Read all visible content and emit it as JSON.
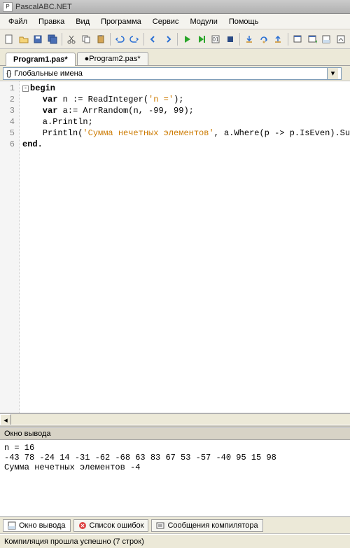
{
  "window": {
    "title": "PascalABC.NET"
  },
  "menu": {
    "file": "Файл",
    "edit": "Правка",
    "view": "Вид",
    "program": "Программа",
    "service": "Сервис",
    "modules": "Модули",
    "help": "Помощь"
  },
  "tabs": {
    "active": "Program1.pas*",
    "other": "●Program2.pas*"
  },
  "scope": {
    "label": "Глобальные имена"
  },
  "code": {
    "line1": "begin",
    "line2_a": "    var",
    "line2_b": " n := ReadInteger(",
    "line2_c": "'n ='",
    "line2_d": ");",
    "line3_a": "    var",
    "line3_b": " a:= ArrRandom(n, -99, 99);",
    "line4": "    a.Println;",
    "line5_a": "    Println(",
    "line5_b": "'Сумма нечетных элементов'",
    "line5_c": ", a.Where(p -> p.IsEven).Sum)",
    "line6": "end."
  },
  "gutter": [
    "1",
    "2",
    "3",
    "4",
    "5",
    "6"
  ],
  "output": {
    "title": "Окно вывода",
    "text": "n = 16\n-43 78 -24 14 -31 -62 -68 63 83 67 53 -57 -40 95 15 98\nСумма нечетных элементов -4"
  },
  "bottomTabs": {
    "output": "Окно вывода",
    "errors": "Список ошибок",
    "compiler": "Сообщения компилятора"
  },
  "status": {
    "text": "Компиляция прошла успешно (7 строк)"
  }
}
